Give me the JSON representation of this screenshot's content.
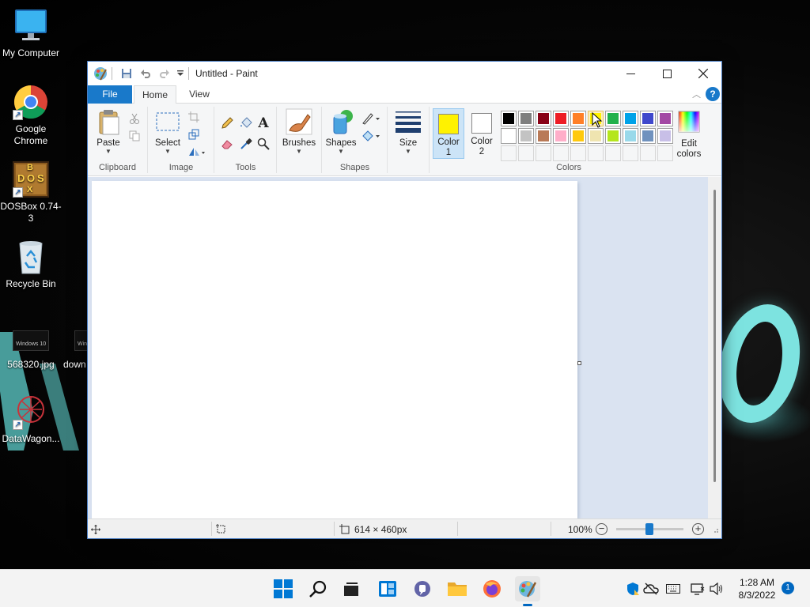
{
  "desktop": {
    "icons": [
      {
        "label": "My Computer"
      },
      {
        "label": "Google Chrome"
      },
      {
        "label": "DOSBox 0.74-3"
      },
      {
        "label": "Recycle Bin"
      },
      {
        "label": "568320.jpg"
      },
      {
        "label": "down"
      },
      {
        "label": "DataWagon..."
      }
    ],
    "thumb_texts": [
      "Windows 10",
      "Win"
    ],
    "dosbox_letters": [
      "B",
      "D",
      "O",
      "S",
      "X"
    ]
  },
  "window": {
    "title": "Untitled - Paint",
    "tabs": {
      "file": "File",
      "home": "Home",
      "view": "View"
    },
    "help": "?",
    "ribbon": {
      "clipboard": {
        "label": "Clipboard",
        "paste": "Paste"
      },
      "image": {
        "label": "Image",
        "select": "Select"
      },
      "tools": {
        "label": "Tools",
        "text_glyph": "A"
      },
      "brushes": {
        "label": "Brushes"
      },
      "shapes": {
        "label": "Shapes",
        "shapes_btn": "Shapes"
      },
      "size": {
        "label": "Size"
      },
      "colors": {
        "label": "Colors",
        "color1": "Color 1",
        "color2": "Color 2",
        "edit_colors": "Edit colors",
        "color1_value": "#fff200",
        "color2_value": "#ffffff",
        "palette_row1": [
          "#000000",
          "#7f7f7f",
          "#880015",
          "#ed1c24",
          "#ff7f27",
          "#fff200",
          "#22b14c",
          "#00a2e8",
          "#3f48cc",
          "#a349a4"
        ],
        "palette_row2": [
          "#ffffff",
          "#c3c3c3",
          "#b97a57",
          "#ffaec9",
          "#ffc90e",
          "#efe4b0",
          "#b5e61d",
          "#99d9ea",
          "#7092be",
          "#c8bfe7"
        ]
      }
    },
    "statusbar": {
      "dimensions": "614 × 460px",
      "zoom": "100%",
      "zoom_minus": "−",
      "zoom_plus": "+"
    }
  },
  "taskbar": {
    "clock_time": "1:28 AM",
    "clock_date": "8/3/2022",
    "notification_count": "1"
  },
  "colors": {
    "accent": "#1979ca",
    "workspace_bg": "#dae3f1",
    "taskbar_bg": "#f3f3f3"
  }
}
